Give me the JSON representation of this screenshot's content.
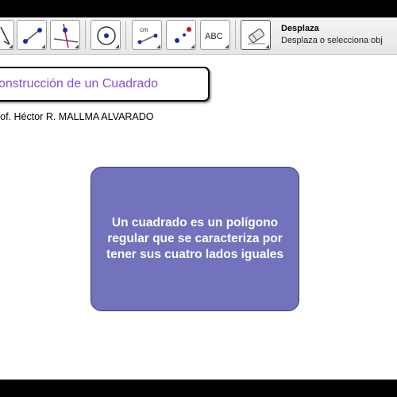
{
  "toolbar": {
    "tools": [
      {
        "name": "move-tool-icon"
      },
      {
        "name": "line-tool-icon"
      },
      {
        "name": "perpendicular-line-tool-icon"
      },
      {
        "name": "circle-tool-icon"
      },
      {
        "name": "distance-tool-icon",
        "label": "cm"
      },
      {
        "name": "reflect-tool-icon"
      },
      {
        "name": "text-tool-icon",
        "label": "ABC"
      },
      {
        "name": "eraser-tool-icon"
      }
    ],
    "active_title": "Desplaza",
    "active_description": "Desplaza o selecciona obj"
  },
  "canvas": {
    "title": "onstrucción de un Cuadrado",
    "author": "rof. Héctor R. MALLMA ALVARADO",
    "note": "Un cuadrado es un polígono regular que se caracteriza por tener sus cuatro lados iguales"
  },
  "colors": {
    "title": "#8a4dd8",
    "note_background": "#7372bd",
    "point_blue": "#1a2aa8",
    "point_red": "#c8102e"
  }
}
